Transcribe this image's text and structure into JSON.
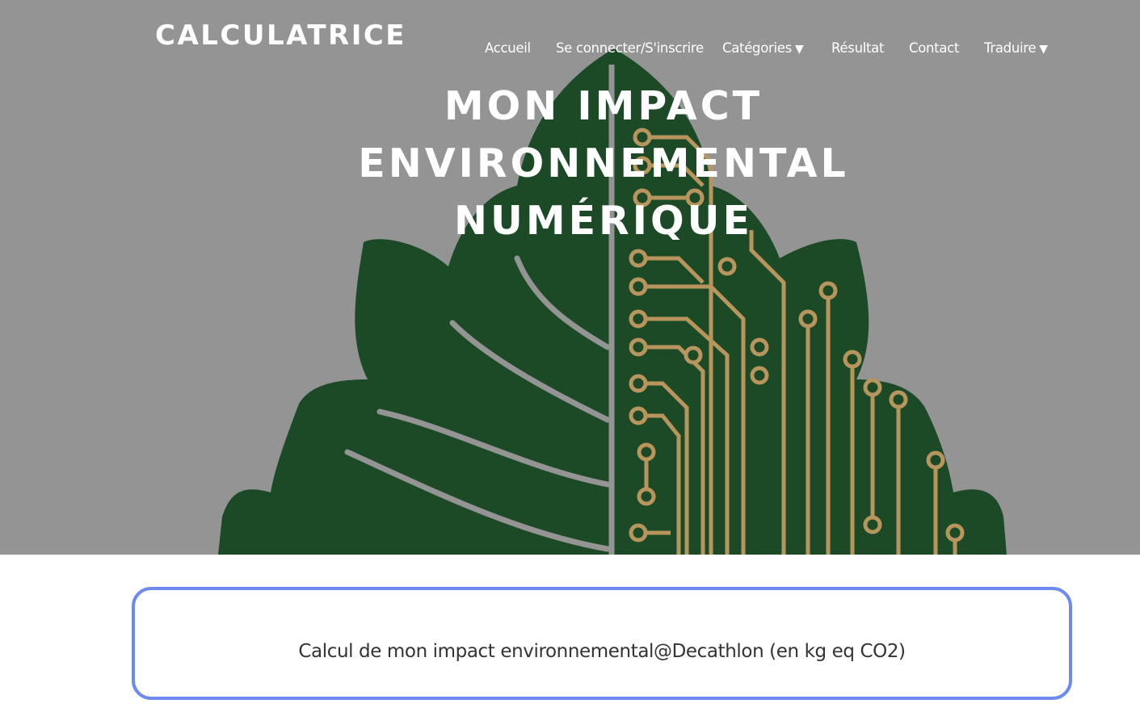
{
  "brand": {
    "title": "CALCULATRICE"
  },
  "nav": {
    "items": [
      {
        "label": "Accueil"
      },
      {
        "label": "Se connecter/S'inscrire"
      },
      {
        "label": "Catégories",
        "caret": "▼"
      },
      {
        "label": "Résultat"
      },
      {
        "label": "Contact"
      },
      {
        "label": "Traduire",
        "caret": "▼"
      }
    ]
  },
  "hero": {
    "title_lines": [
      "MON IMPACT",
      "ENVIRONNEMENTAL",
      "NUMÉRIQUE"
    ],
    "image": "leaf-circuit-icon",
    "colors": {
      "overlay_gray": "#949494",
      "leaf_green": "#1c4a26",
      "circuit_gold": "#b8955c"
    }
  },
  "calculator": {
    "heading": "Calcul de mon impact environnemental@Decathlon (en kg eq CO2)",
    "border_color": "#6c8af0"
  }
}
